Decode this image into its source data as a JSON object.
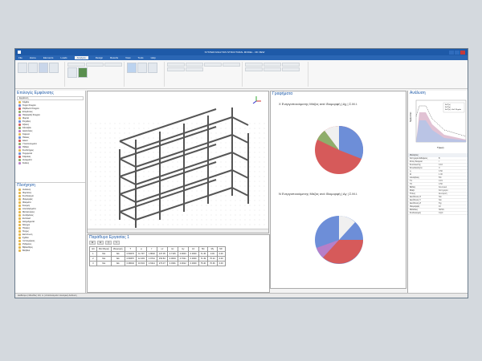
{
  "window": {
    "title": "SYSTEM ANALYSIS STRUCTURAL MODEL - 3D VIEW"
  },
  "menu": [
    "File",
    "Home",
    "Elements",
    "Loads",
    "Analysis",
    "Design",
    "Results",
    "View",
    "Tools",
    "Help"
  ],
  "menu_active_index": 4,
  "left_panel": {
    "title": "Επιλογές Εμφάνισης",
    "filter_label": "Εμφάνιση",
    "items": [
      "Κόμβοι",
      "Τοιχία Στοιχεία",
      "Ραβδωτά Στοιχεία",
      "Επιφάνειες",
      "Πλακοειδή Στοιχεία",
      "Φορτία",
      "Στηρίξεις",
      "Άξονες",
      "Κάνναβοι",
      "Διαστάσεις",
      "Κείμενα",
      "Πλάκες",
      "Δοκοί",
      "Υποστυλώματα",
      "Πέδιλα",
      "Συνδετήριες",
      "Τοιχώματα",
      "Κλίμακες",
      "Ανοίγματα",
      "Σκάλες"
    ]
  },
  "nav_panel": {
    "title": "Πλοήγηση",
    "items": [
      "Ανάλυση",
      "Φορτίσεις",
      "Συνδυασμοί",
      "Ιδιομορφές",
      "Φάσματα",
      "Σεισμός",
      "Αποτελέσματα",
      "Μετακινήσεις",
      "Αντιδράσεις",
      "Εντατικά",
      "Διαγράμματα",
      "Έλεγχοι",
      "Πίνακες",
      "Τεύχος",
      "Εκτύπωση",
      "Σχέδια",
      "Λεπτομέρειες",
      "Ρυθμίσεις",
      "Βιβλιοθήκη",
      "Βοήθεια"
    ]
  },
  "charts_panel": {
    "title": "Γραφήματα",
    "pie1_title": "Χ Ενεργοποιούμενης Μάζας ανά Ιδιομορφή | Δχ | Σ.Μ.Ι.",
    "pie2_title": "Ν Ενεργοποιούμενης Μάζας ανά Ιδιομορφή | Δy | Σ.Μ.Ι."
  },
  "analysis_panel": {
    "title": "Ανάλυση",
    "ylabel": "S(d) m/s²",
    "xlabel": "T(sec)",
    "legend": [
      "Sd Τ(x)",
      "Sd Τ(y)",
      "Sd Τ(x) - Θ=1.20 grids"
    ],
    "props_title": "Ιδιότητες",
    "props": [
      [
        "Κατηγορία Εδάφους",
        "B"
      ],
      [
        "Ζώνη Σεισμού",
        "I"
      ],
      [
        "Συντελεστής",
        "0.16"
      ],
      [
        "Σπουδαιότητα",
        "II"
      ],
      [
        "q",
        "3.50"
      ],
      [
        "Θ",
        "1.00"
      ],
      [
        "Απόσβεση",
        "5%"
      ],
      [
        "T1",
        "0.15"
      ],
      [
        "T2",
        "0.50"
      ],
      [
        "Βάθος",
        "Κανονικό"
      ],
      [
        "Μάζα",
        "Κατηγορία"
      ],
      [
        "Τύπος",
        "Δυναμική"
      ],
      [
        "Διεύθυνση Χ",
        "Ναι"
      ],
      [
        "Διεύθυνση Υ",
        "Ναι"
      ],
      [
        "Διεύθυνση Ζ",
        "Όχι"
      ],
      [
        "Ιδιομορφές",
        "10"
      ],
      [
        "Μέθοδος",
        "SRSS"
      ],
      [
        "Συνδυασμός",
        "CQC"
      ]
    ]
  },
  "bottom_panel": {
    "title": "Παράθυρο Εργασίας 1",
    "table_headers": [
      "α/α",
      "Ιδιο Μορφή",
      "Ιδιομορφή",
      "Τ",
      "ω",
      "f",
      "ω²",
      "mx",
      "my",
      "mz",
      "Mx",
      "My",
      "Mz"
    ],
    "rows": [
      [
        "1",
        "Ναι",
        "Ναι",
        "0.53670",
        "11.707",
        "1.8632",
        "137.05",
        "0.7145",
        "0.0003",
        "0.0000",
        "71.45",
        "0.03",
        "0.00"
      ],
      [
        "2",
        "Ναι",
        "Ναι",
        "0.50657",
        "12.403",
        "1.9741",
        "153.84",
        "0.0004",
        "0.7021",
        "0.0000",
        "71.49",
        "70.24",
        "0.00"
      ],
      [
        "3",
        "Ναι",
        "Ναι",
        "0.38002",
        "16.534",
        "2.6314",
        "273.37",
        "0.0391",
        "0.0012",
        "0.0000",
        "75.40",
        "70.36",
        "0.00"
      ]
    ]
  },
  "status": "Διαθέσιμο | Μονάδες: kN, m | Αποτελέσματα: Δυναμική Ανάλυση",
  "colors": {
    "accent": "#1e5aa8",
    "pie_blue": "#6d8ed8",
    "pie_red": "#d65a5a",
    "pie_white": "#f0f0f0"
  }
}
